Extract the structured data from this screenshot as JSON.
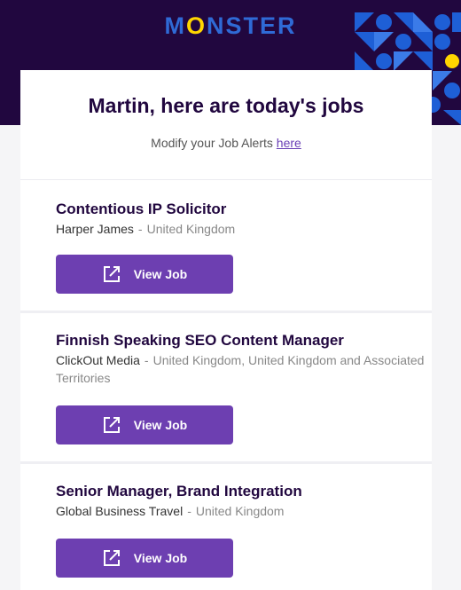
{
  "brand": {
    "logo_pre": "M",
    "logo_o": "O",
    "logo_post": "NSTER"
  },
  "heading": "Martin, here are today's jobs",
  "alerts": {
    "text": "Modify your Job Alerts ",
    "link": "here"
  },
  "jobs": [
    {
      "title": "Contentious IP Solicitor",
      "company": "Harper James",
      "separator": "-",
      "location": "United Kingdom",
      "button": "View Job"
    },
    {
      "title": "Finnish Speaking SEO Content Manager",
      "company": "ClickOut Media",
      "separator": "-",
      "location": "United Kingdom, United Kingdom and Associated Territories",
      "button": "View Job"
    },
    {
      "title": "Senior Manager, Brand Integration",
      "company": "Global Business Travel",
      "separator": "-",
      "location": "United Kingdom",
      "button": "View Job"
    }
  ],
  "colors": {
    "header_bg": "#21073f",
    "button_bg": "#6d3fb1",
    "logo_blue": "#2f6ad6",
    "logo_yellow": "#ffd600"
  },
  "icons": {
    "view_job": "external-link-icon",
    "pattern": "geometric-pattern"
  }
}
